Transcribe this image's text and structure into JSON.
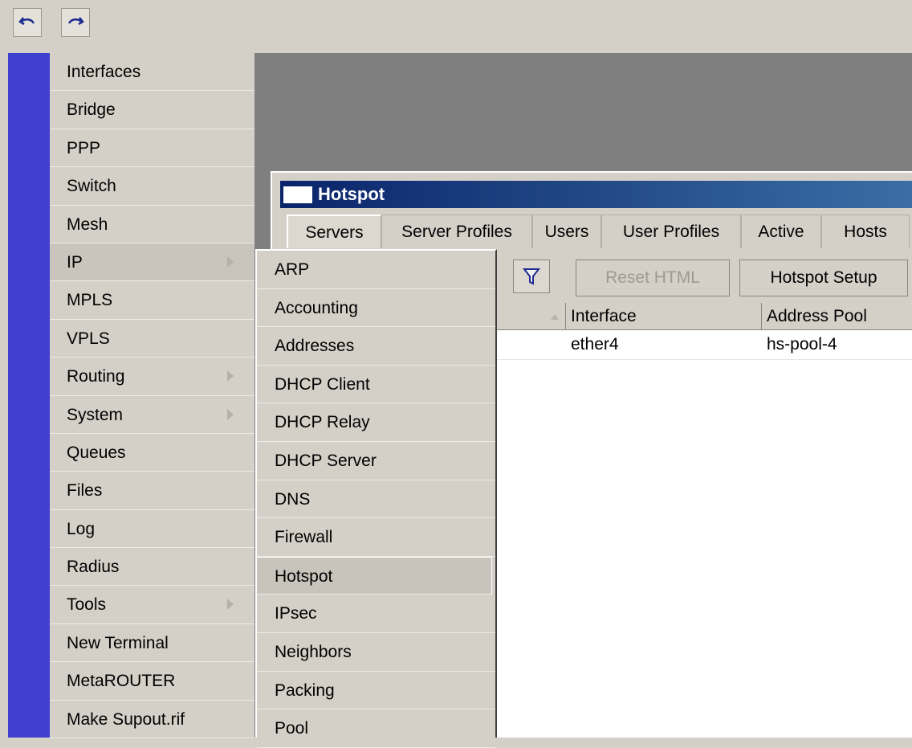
{
  "toolbar": {
    "buttons": [
      {
        "name": "undo",
        "icon": "undo-icon"
      },
      {
        "name": "redo",
        "icon": "redo-icon"
      }
    ]
  },
  "main_menu": {
    "items": [
      {
        "label": "Interfaces",
        "submenu": false
      },
      {
        "label": "Bridge",
        "submenu": false
      },
      {
        "label": "PPP",
        "submenu": false
      },
      {
        "label": "Switch",
        "submenu": false
      },
      {
        "label": "Mesh",
        "submenu": false
      },
      {
        "label": "IP",
        "submenu": true,
        "selected": true
      },
      {
        "label": "MPLS",
        "submenu": false
      },
      {
        "label": "VPLS",
        "submenu": false
      },
      {
        "label": "Routing",
        "submenu": true
      },
      {
        "label": "System",
        "submenu": true
      },
      {
        "label": "Queues",
        "submenu": false
      },
      {
        "label": "Files",
        "submenu": false
      },
      {
        "label": "Log",
        "submenu": false
      },
      {
        "label": "Radius",
        "submenu": false
      },
      {
        "label": "Tools",
        "submenu": true
      },
      {
        "label": "New Terminal",
        "submenu": false
      },
      {
        "label": "MetaROUTER",
        "submenu": false
      },
      {
        "label": "Make Supout.rif",
        "submenu": false
      }
    ]
  },
  "ip_menu": {
    "items": [
      {
        "label": "ARP"
      },
      {
        "label": "Accounting"
      },
      {
        "label": "Addresses"
      },
      {
        "label": "DHCP Client"
      },
      {
        "label": "DHCP Relay"
      },
      {
        "label": "DHCP Server"
      },
      {
        "label": "DNS"
      },
      {
        "label": "Firewall"
      },
      {
        "label": "Hotspot",
        "highlighted": true
      },
      {
        "label": "IPsec"
      },
      {
        "label": "Neighbors"
      },
      {
        "label": "Packing"
      },
      {
        "label": "Pool"
      }
    ]
  },
  "hotspot_window": {
    "title": "Hotspot",
    "tabs": [
      "Servers",
      "Server Profiles",
      "Users",
      "User Profiles",
      "Active",
      "Hosts"
    ],
    "active_tab": "Servers",
    "buttons": {
      "reset_html": "Reset HTML",
      "hotspot_setup": "Hotspot Setup"
    },
    "columns": [
      "Interface",
      "Address Pool"
    ],
    "rows": [
      {
        "interface": "ether4",
        "address_pool": "hs-pool-4"
      }
    ]
  },
  "colors": {
    "accent_bar": "#3f3fd0",
    "title_bar_start": "#0a246a",
    "title_bar_end": "#3a6ea5",
    "face": "#d4d0c8",
    "workspace": "#7f7f7f"
  }
}
